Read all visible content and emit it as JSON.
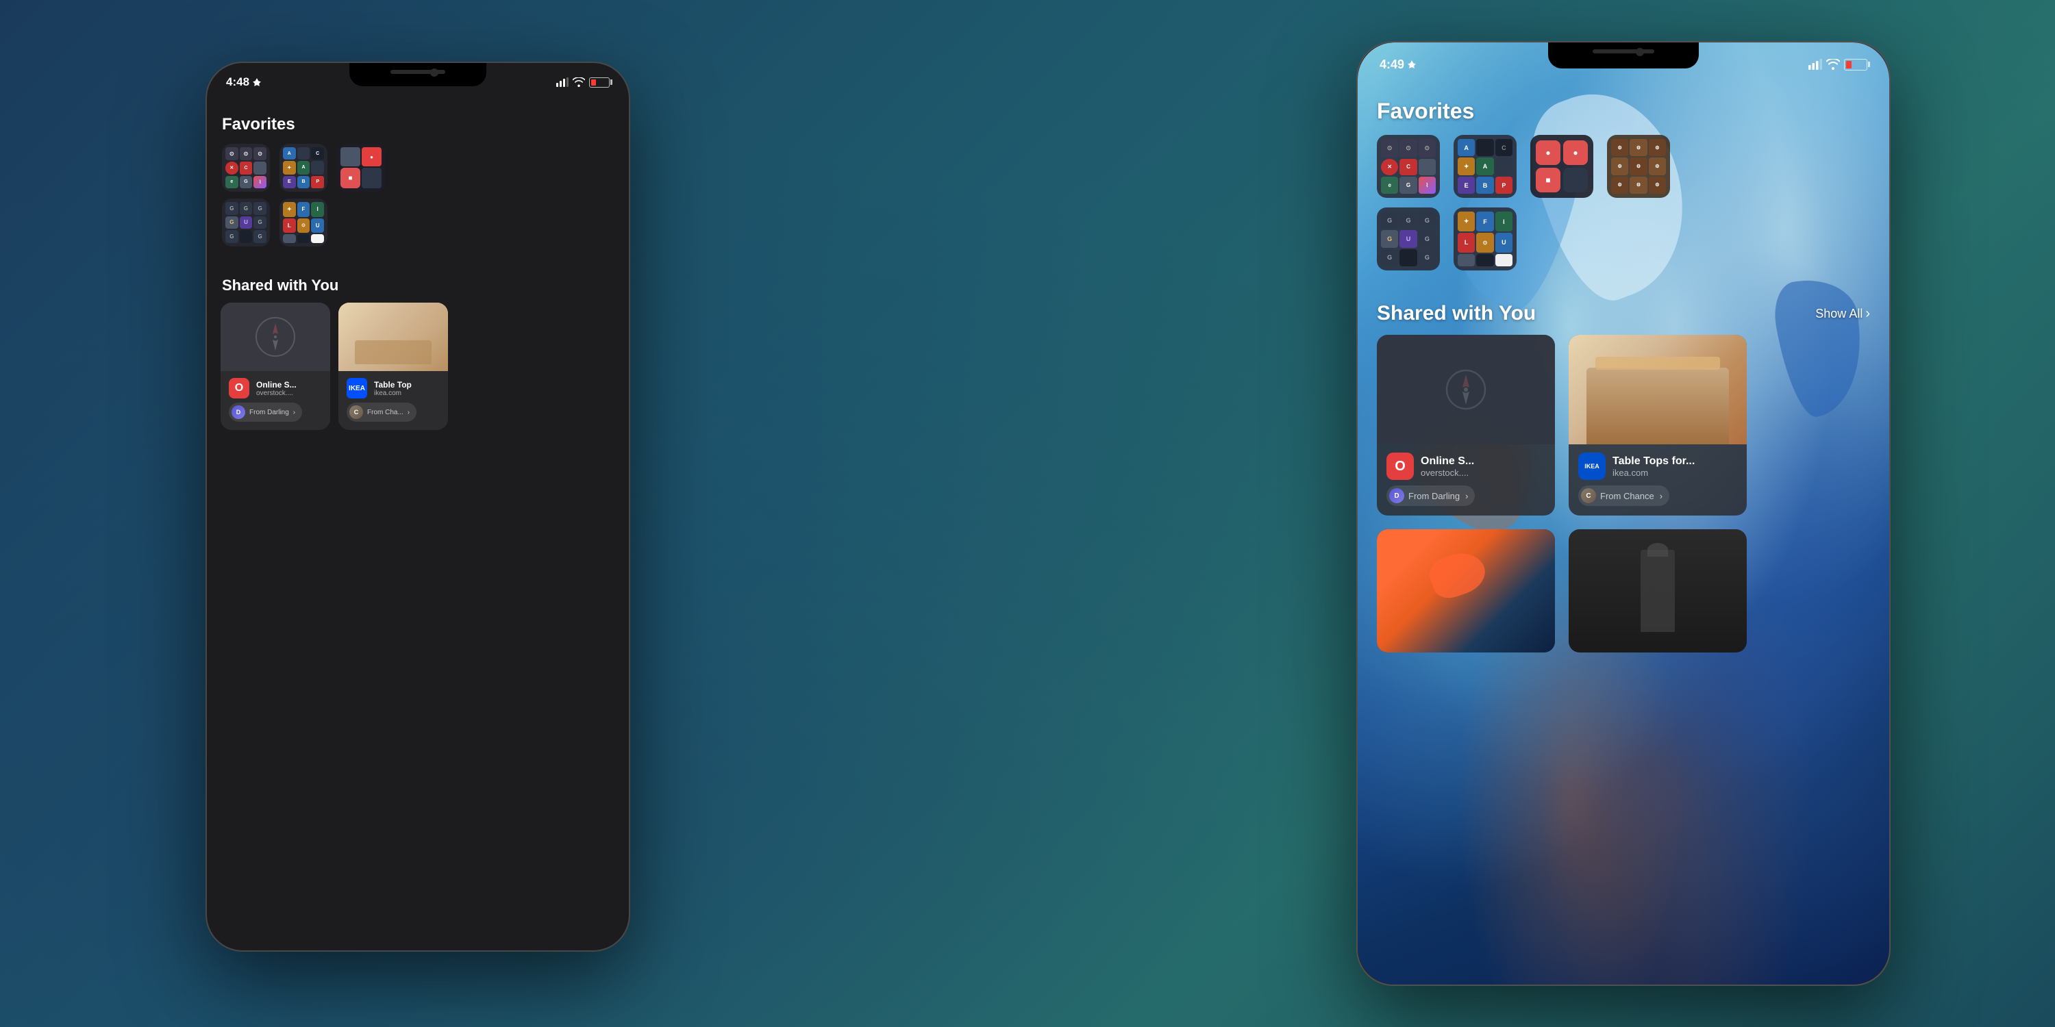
{
  "background": {
    "gradient_description": "dark teal to blue gradient"
  },
  "phone_back": {
    "status_bar": {
      "time": "4:48",
      "has_location": true
    },
    "favorites_title": "Favorites",
    "shared_title": "Shared with You",
    "shared_cards": [
      {
        "type": "safari_placeholder",
        "title": "Online S...",
        "domain": "overstock....",
        "from_label": "From Darling",
        "has_image": false
      },
      {
        "type": "table_top",
        "title": "Table Top",
        "domain": "ikea.com",
        "from_label": "From Cha...",
        "has_image": true
      }
    ]
  },
  "phone_front": {
    "status_bar": {
      "time": "4:49",
      "has_location": true
    },
    "favorites_title": "Favorites",
    "folder_groups": [
      {
        "id": "folder1",
        "type": "3x3"
      },
      {
        "id": "folder2",
        "type": "3x3"
      },
      {
        "id": "folder3",
        "type": "2x2"
      },
      {
        "id": "folder4",
        "type": "3x3_brown"
      }
    ],
    "folder_row2": [
      {
        "id": "folder5",
        "type": "3x3_g"
      },
      {
        "id": "folder6",
        "type": "3x3_fi"
      }
    ],
    "shared_with_you_title": "Shared with You",
    "show_all_label": "Show All",
    "shared_cards": [
      {
        "type": "safari_placeholder",
        "title": "Online S...",
        "domain": "overstock....",
        "from_label": "From Darling",
        "from_initial": "D"
      },
      {
        "type": "table_top",
        "title": "Table Tops for...",
        "domain": "ikea.com",
        "from_label": "From Chance",
        "from_initial": "C"
      }
    ]
  },
  "icons": {
    "chevron_right": "›",
    "location_arrow": "➤",
    "compass": "⊕"
  }
}
